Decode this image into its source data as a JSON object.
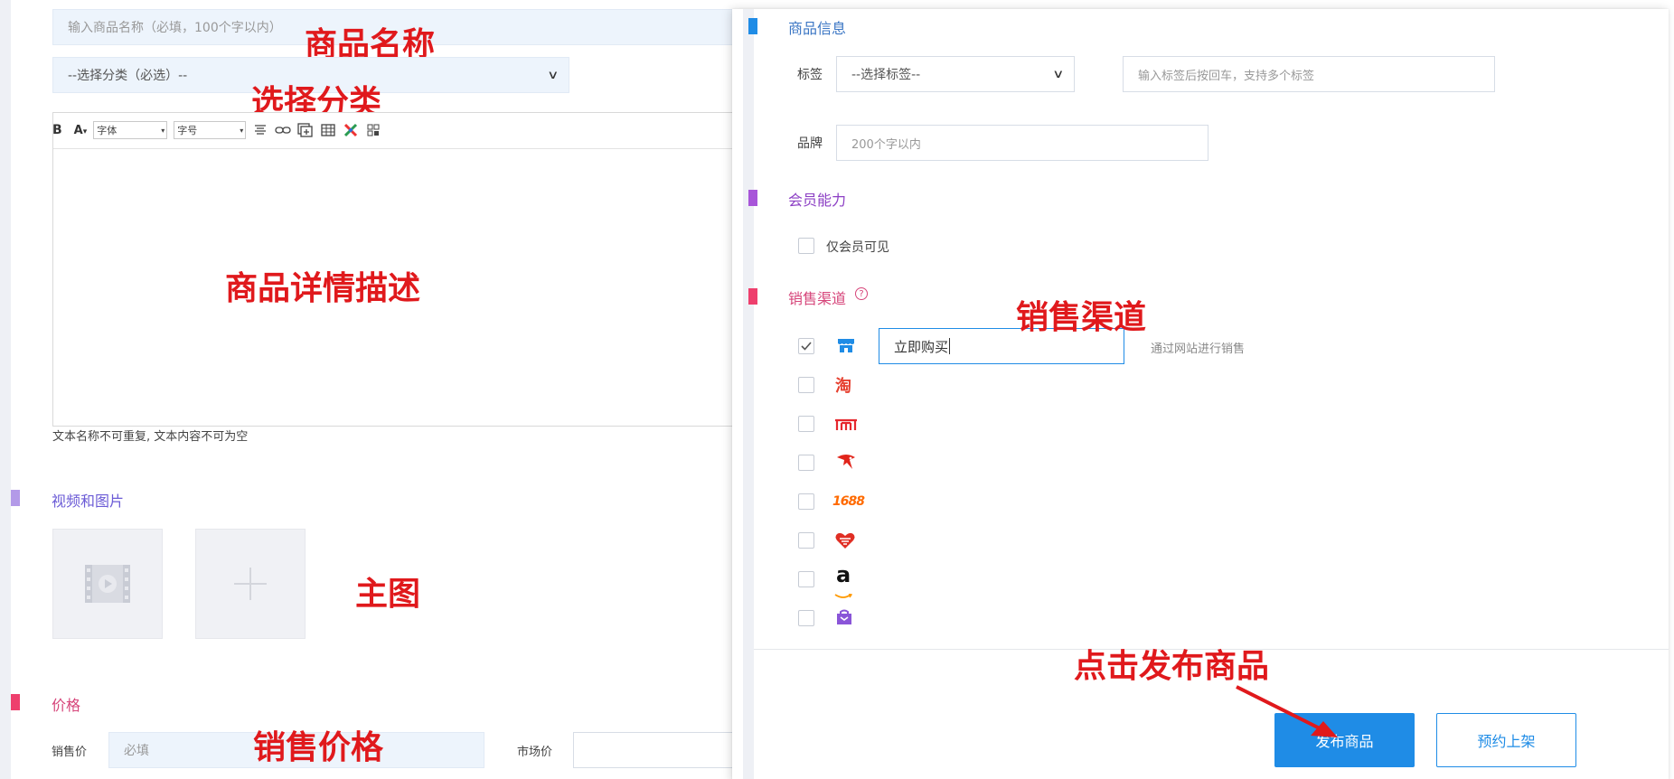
{
  "product_form": {
    "name_placeholder": "输入商品名称（必填，100个字以内）",
    "category_select": "--选择分类（必选）--",
    "editor": {
      "bold_label": "B",
      "font_color_label": "A",
      "font_select": "字体",
      "size_select": "字号"
    },
    "editor_hint": "文本名称不可重复, 文本内容不可为空",
    "media_section_title": "视频和图片",
    "price_section_title": "价格",
    "sale_price_label": "销售价",
    "sale_price_placeholder": "必填",
    "market_price_label": "市场价"
  },
  "annotations": {
    "name": "商品名称",
    "category": "选择分类",
    "description": "商品详情描述",
    "main_image": "主图",
    "sale_price": "销售价格",
    "channels": "销售渠道",
    "publish": "点击发布商品"
  },
  "panel": {
    "product_info_title": "商品信息",
    "tag_label": "标签",
    "tag_select": "--选择标签--",
    "tag_input_placeholder": "输入标签后按回车，支持多个标签",
    "brand_label": "品牌",
    "brand_placeholder": "200个字以内",
    "member_title": "会员能力",
    "member_only_label": "仅会员可见",
    "channels_title": "销售渠道",
    "channels": [
      {
        "icon": "store-icon",
        "checked": true,
        "button_text": "立即购买",
        "desc": "通过网站进行销售"
      },
      {
        "icon": "taobao-icon",
        "checked": false,
        "glyph": "淘"
      },
      {
        "icon": "tmall-icon",
        "checked": false
      },
      {
        "icon": "jd-icon",
        "checked": false
      },
      {
        "icon": "1688-icon",
        "checked": false,
        "glyph": "1688"
      },
      {
        "icon": "pinduoduo-icon",
        "checked": false
      },
      {
        "icon": "amazon-icon",
        "checked": false,
        "glyph": "a"
      },
      {
        "icon": "bag-icon",
        "checked": false
      }
    ],
    "publish_button": "发布商品",
    "schedule_button": "预约上架"
  },
  "colors": {
    "primary": "#1f8ce6",
    "annotation": "#e0191c",
    "marker_blue": "#1f8ce6",
    "marker_purple": "#a855d9",
    "marker_media": "#b39ae8",
    "marker_pink": "#ee3f6d"
  }
}
